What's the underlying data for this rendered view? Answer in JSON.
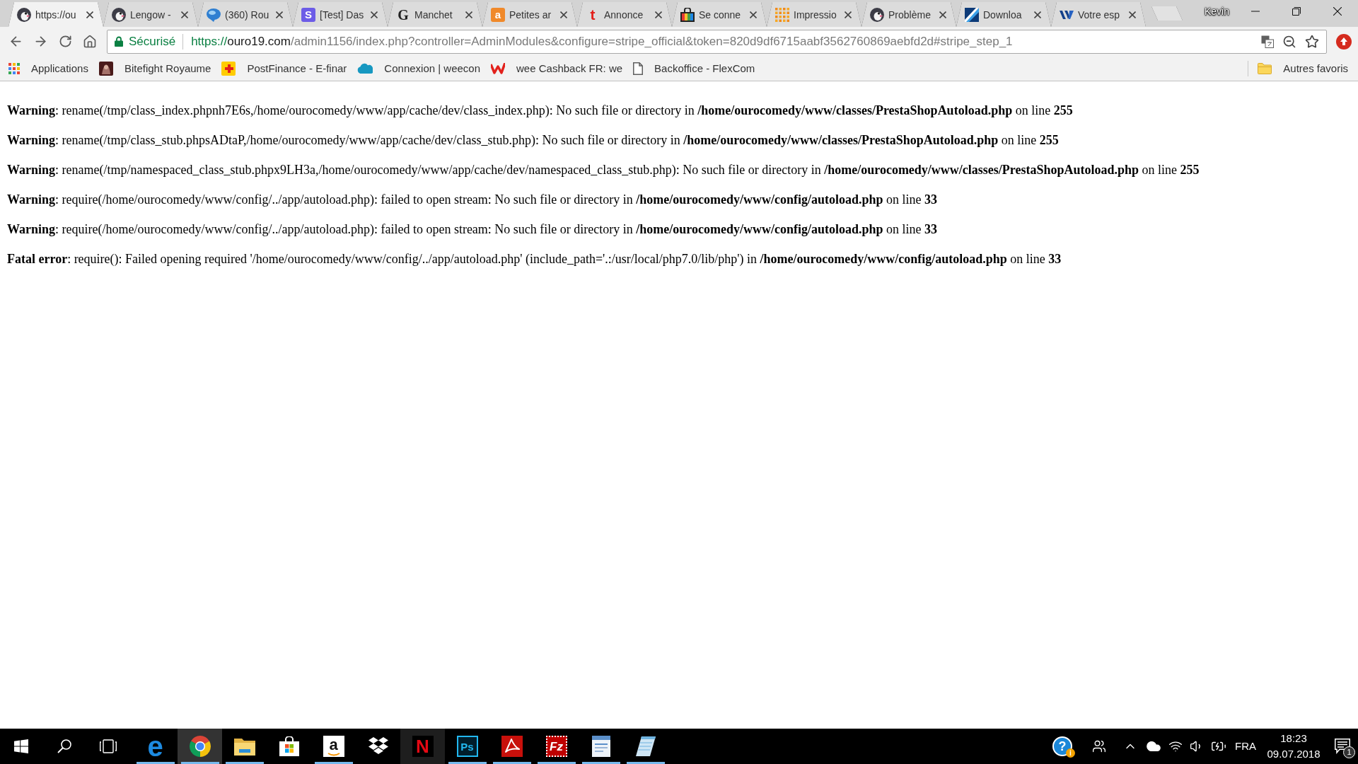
{
  "window": {
    "profile": "Kevin"
  },
  "tabs": [
    {
      "title": "https://ou",
      "favicon": {
        "kind": "penguin"
      },
      "selected": true
    },
    {
      "title": "Lengow -",
      "favicon": {
        "kind": "penguin"
      },
      "selected": false
    },
    {
      "title": "(360) Rou",
      "favicon": {
        "kind": "bubble"
      },
      "selected": false
    },
    {
      "title": "[Test] Das",
      "favicon": {
        "kind": "tile",
        "text": "S",
        "color": "#6c5ce7"
      },
      "selected": false
    },
    {
      "title": "Manchet",
      "favicon": {
        "kind": "serif",
        "text": "G",
        "color": "#222222"
      },
      "selected": false
    },
    {
      "title": "Petites ar",
      "favicon": {
        "kind": "tile",
        "text": "a",
        "color": "#f0892a"
      },
      "selected": false
    },
    {
      "title": "Annonce",
      "favicon": {
        "kind": "letter",
        "text": "t",
        "color": "#e3211c"
      },
      "selected": false
    },
    {
      "title": "Se conne",
      "favicon": {
        "kind": "bag"
      },
      "selected": false
    },
    {
      "title": "Impressio",
      "favicon": {
        "kind": "dots"
      },
      "selected": false
    },
    {
      "title": "Problème",
      "favicon": {
        "kind": "penguin"
      },
      "selected": false
    },
    {
      "title": "Downloa",
      "favicon": {
        "kind": "stripe"
      },
      "selected": false
    },
    {
      "title": "Votre esp",
      "favicon": {
        "kind": "wave"
      },
      "selected": false
    }
  ],
  "toolbar": {
    "security": "Sécurisé",
    "address": {
      "scheme": "https://",
      "host": "ouro19.com",
      "rest": "/admin1156/index.php?controller=AdminModules&configure=stripe_official&token=820d9df6715aabf3562760869aebfd2d#stripe_step_1"
    },
    "bookmarked": false
  },
  "bookmarks": {
    "items": [
      {
        "label": "Applications",
        "kind": "apps"
      },
      {
        "label": "Bitefight Royaume",
        "kind": "picture"
      },
      {
        "label": "PostFinance - E-finar",
        "kind": "square"
      },
      {
        "label": "Connexion | weecon",
        "kind": "cloud"
      },
      {
        "label": "wee Cashback FR: we",
        "kind": "zigzag"
      },
      {
        "label": "Backoffice - FlexCom",
        "kind": "page"
      }
    ],
    "other": "Autres favoris"
  },
  "page": {
    "messages": [
      "**Warning**: rename(/tmp/class_index.phpnh7E6s,/home/ourocomedy/www/app/cache/dev/class_index.php): No such file or directory in **/home/ourocomedy/www/classes/PrestaShopAutoload.php** on line **255**",
      "**Warning**: rename(/tmp/class_stub.phpsADtaP,/home/ourocomedy/www/app/cache/dev/class_stub.php): No such file or directory in **/home/ourocomedy/www/classes/PrestaShopAutoload.php** on line **255**",
      "**Warning**: rename(/tmp/namespaced_class_stub.phpx9LH3a,/home/ourocomedy/www/app/cache/dev/namespaced_class_stub.php): No such file or directory in **/home/ourocomedy/www/classes/PrestaShopAutoload.php** on line **255**",
      "**Warning**: require(/home/ourocomedy/www/config/../app/autoload.php): failed to open stream: No such file or directory in **/home/ourocomedy/www/config/autoload.php** on line **33**",
      "**Warning**: require(/home/ourocomedy/www/config/../app/autoload.php): failed to open stream: No such file or directory in **/home/ourocomedy/www/config/autoload.php** on line **33**",
      "**Fatal error**: require(): Failed opening required '/home/ourocomedy/www/config/../app/autoload.php' (include_path='.:/usr/local/php7.0/lib/php') in **/home/ourocomedy/www/config/autoload.php** on line **33**"
    ]
  },
  "taskbar": {
    "apps": [
      {
        "kind": "edge",
        "text": "e",
        "running": true,
        "selected": false,
        "hovered": false
      },
      {
        "kind": "chrome",
        "running": true,
        "selected": true,
        "hovered": false
      },
      {
        "kind": "folder",
        "running": true,
        "selected": false,
        "hovered": false
      },
      {
        "kind": "store",
        "running": false,
        "selected": false,
        "hovered": false
      },
      {
        "kind": "amazon",
        "text": "a",
        "running": true,
        "selected": false,
        "hovered": false
      },
      {
        "kind": "dropbox",
        "running": false,
        "selected": false,
        "hovered": false
      },
      {
        "kind": "netflix",
        "text": "N",
        "running": false,
        "selected": false,
        "hovered": true
      },
      {
        "kind": "photoshop",
        "text": "Ps",
        "running": true,
        "selected": false,
        "hovered": false
      },
      {
        "kind": "acrobat",
        "running": true,
        "selected": false,
        "hovered": false
      },
      {
        "kind": "filezilla",
        "text": "Fz",
        "running": true,
        "selected": false,
        "hovered": false
      },
      {
        "kind": "wordpad",
        "running": true,
        "selected": false,
        "hovered": false
      },
      {
        "kind": "notepad",
        "running": true,
        "selected": false,
        "hovered": false
      }
    ],
    "tray": {
      "help": {
        "text": "?",
        "badge": "i"
      },
      "language": "FRA",
      "time": "18:23",
      "date": "09.07.2018",
      "notifications": "1"
    }
  }
}
